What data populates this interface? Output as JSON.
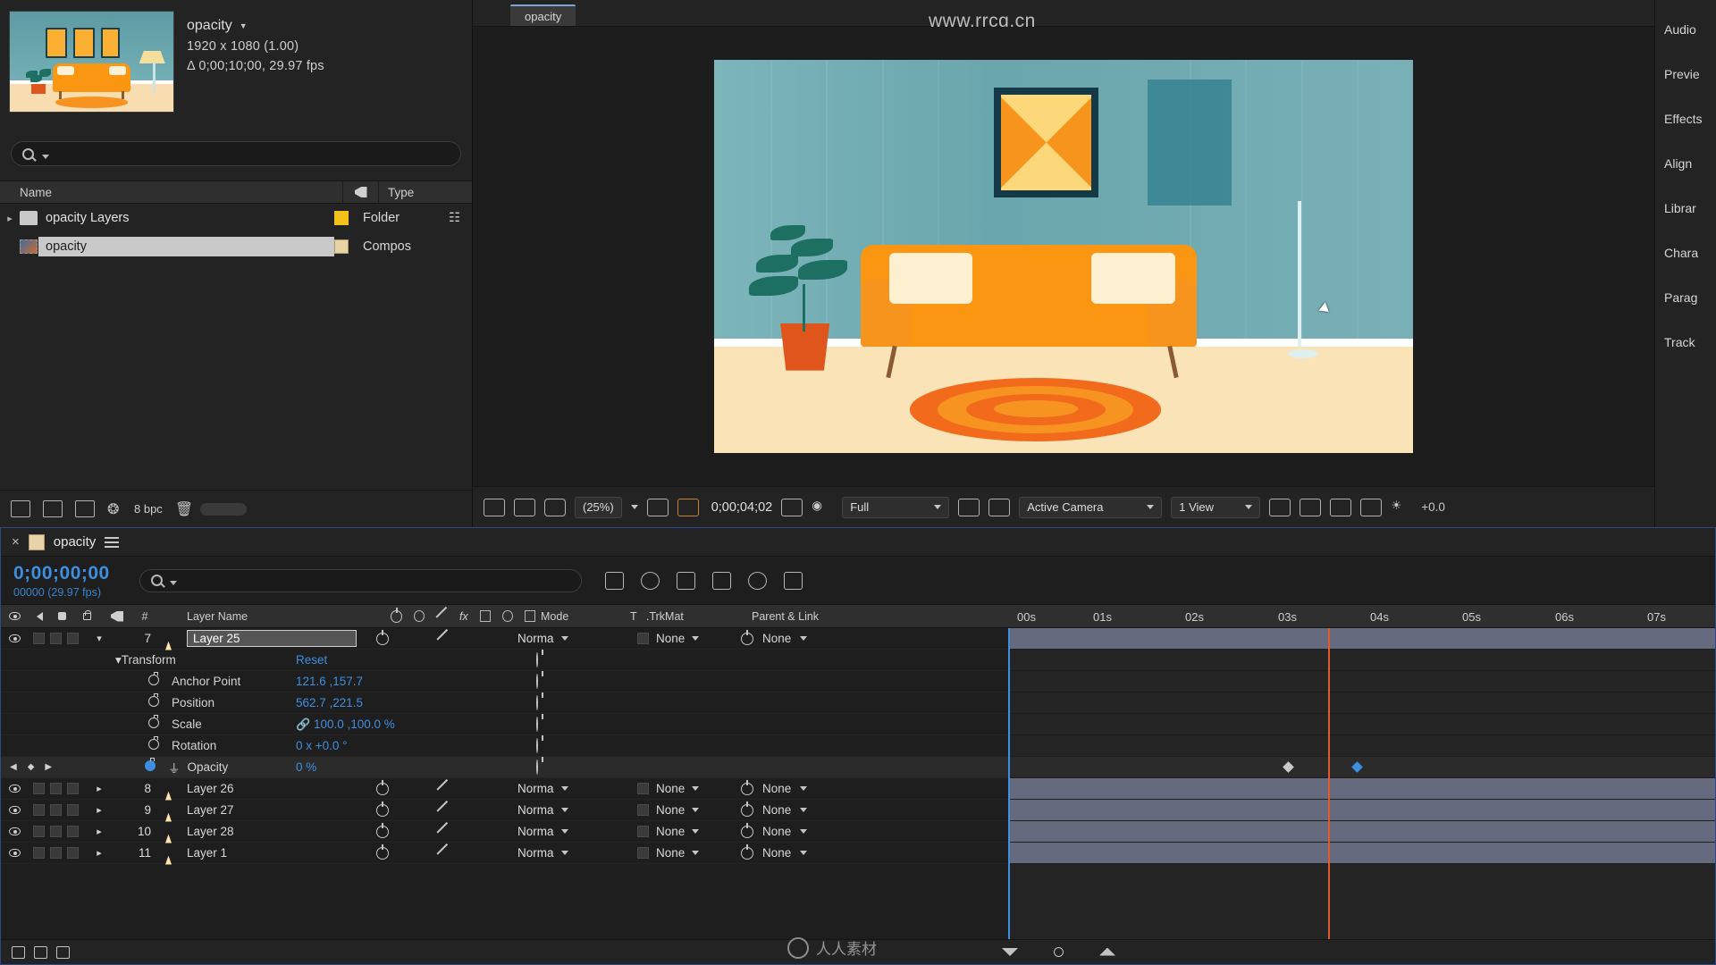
{
  "project": {
    "title": "opacity",
    "resolution": "1920 x 1080 (1.00)",
    "duration": "Δ 0;00;10;00, 29.97 fps",
    "search_placeholder": "",
    "columns": {
      "name": "Name",
      "tag": "tag-icon",
      "type": "Type"
    },
    "items": [
      {
        "name": "opacity Layers",
        "type": "Folder",
        "swatch": "#f3c11a",
        "kind": "folder",
        "selected": false,
        "expandable": true
      },
      {
        "name": "opacity",
        "type": "Compos",
        "swatch": "#e8d2a8",
        "kind": "comp",
        "selected": true,
        "expandable": false
      }
    ],
    "bottom": {
      "bpc": "8 bpc"
    }
  },
  "viewer": {
    "tab": "opacity",
    "watermark": "www.rrcg.cn",
    "toolbar": {
      "zoom": "(25%)",
      "timecode": "0;00;04;02",
      "quality": "Full",
      "camera": "Active Camera",
      "views": "1 View",
      "exposure": "+0.0"
    }
  },
  "right_dock": {
    "items": [
      "Audio",
      "Previe",
      "Effects",
      "Align",
      "Librar",
      "Chara",
      "Parag",
      "Track"
    ]
  },
  "timeline": {
    "tab": "opacity",
    "current_time": "0;00;00;00",
    "current_frame": "00000 (29.97 fps)",
    "search_placeholder": "",
    "columns": {
      "layer_name": "Layer Name",
      "mode": "Mode",
      "t": "T",
      "trkmat": ".TrkMat",
      "parent": "Parent & Link",
      "hash": "#"
    },
    "ruler_labels": [
      "00s",
      "01s",
      "02s",
      "03s",
      "04s",
      "05s",
      "06s",
      "07s"
    ],
    "layers": [
      {
        "index": "7",
        "name": "Layer 25",
        "editing": true,
        "mode": "Norma",
        "trkmat": "None",
        "parent": "None",
        "expanded": true,
        "transform": {
          "label": "Transform",
          "reset": "Reset",
          "properties": [
            {
              "name": "Anchor Point",
              "value": "121.6 ,157.7",
              "stopwatch": false
            },
            {
              "name": "Position",
              "value": "562.7 ,221.5",
              "stopwatch": false
            },
            {
              "name": "Scale",
              "value": "100.0 ,100.0 %",
              "stopwatch": false,
              "chain": true
            },
            {
              "name": "Rotation",
              "value": "0 x +0.0 °",
              "stopwatch": false
            },
            {
              "name": "Opacity",
              "value": "0 %",
              "stopwatch": true
            }
          ]
        }
      },
      {
        "index": "8",
        "name": "Layer 26",
        "editing": false,
        "mode": "Norma",
        "trkmat": "None",
        "parent": "None",
        "expanded": false
      },
      {
        "index": "9",
        "name": "Layer 27",
        "editing": false,
        "mode": "Norma",
        "trkmat": "None",
        "parent": "None",
        "expanded": false
      },
      {
        "index": "10",
        "name": "Layer 28",
        "editing": false,
        "mode": "Norma",
        "trkmat": "None",
        "parent": "None",
        "expanded": false
      },
      {
        "index": "11",
        "name": "Layer 1",
        "editing": false,
        "mode": "Norma",
        "trkmat": "None",
        "parent": "None",
        "expanded": false
      }
    ]
  },
  "watermark_text": "人人素材",
  "colors": {
    "accent_blue": "#3e8fe0",
    "playhead": "#3e8fe0",
    "current_time_line": "#e05a2b",
    "panel_bg": "#232323",
    "orange": "#fb9612"
  }
}
